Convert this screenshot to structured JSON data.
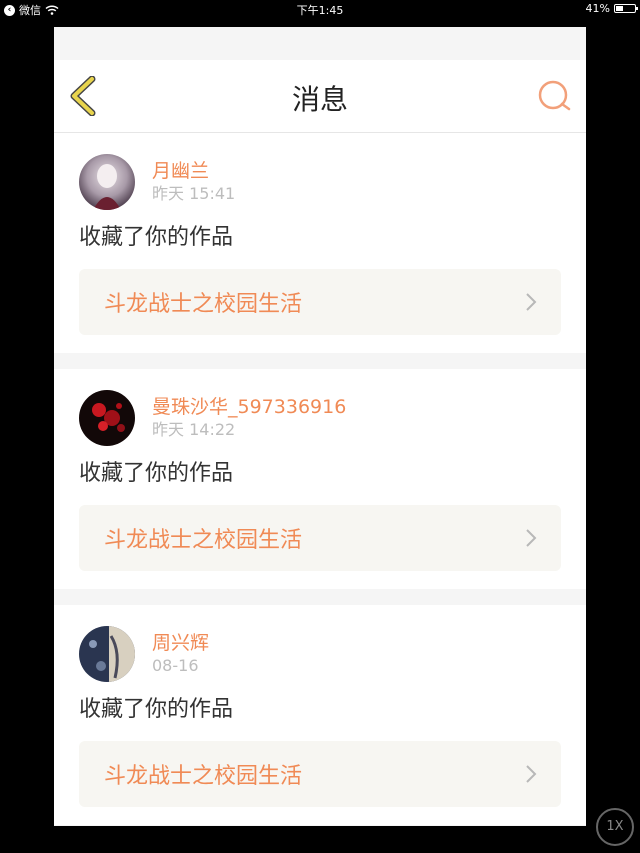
{
  "status_bar": {
    "back_app": "微信",
    "time": "下午1:45",
    "battery": "41%",
    "battery_level": 0.41
  },
  "nav": {
    "title": "消息"
  },
  "messages": [
    {
      "user": "月幽兰",
      "time": "昨天 15:41",
      "action": "收藏了你的作品",
      "work": "斗龙战士之校园生活",
      "avatar_colors": [
        "#3a2a3a",
        "#e8e0e6"
      ]
    },
    {
      "user": "曼珠沙华_597336916",
      "time": "昨天 14:22",
      "action": "收藏了你的作品",
      "work": "斗龙战士之校园生活",
      "avatar_colors": [
        "#120808",
        "#c81820"
      ]
    },
    {
      "user": "周兴辉",
      "time": "08-16",
      "action": "收藏了你的作品",
      "work": "斗龙战士之校园生活",
      "avatar_colors": [
        "#2a3550",
        "#d8d0c0"
      ]
    }
  ],
  "zoom_badge": "1X",
  "colors": {
    "accent": "#f08a55",
    "back_arrow": "#e8d44d",
    "search_icon": "#f2a07a"
  }
}
